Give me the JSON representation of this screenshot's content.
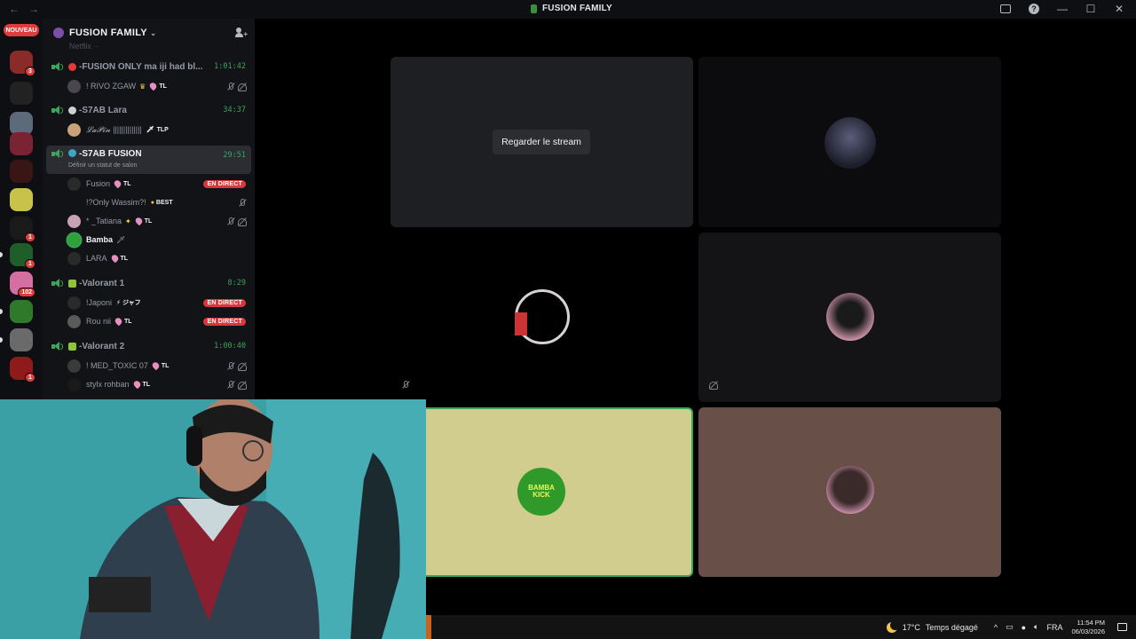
{
  "titlebar": {
    "back": "←",
    "forward": "→",
    "title": "FUSION FAMILY",
    "minimize": "—",
    "maximize": "☐",
    "close": "✕"
  },
  "rail": {
    "nouveau": "NOUVEAU",
    "servers": [
      {
        "badge": "3",
        "color": "#8c2a2a"
      },
      {
        "badge": "",
        "color": "#222222"
      },
      {
        "badge": "",
        "color": "#5d6a7b"
      },
      {
        "badge": "",
        "color": "#7a2332"
      },
      {
        "badge": "",
        "color": "#3a1515"
      },
      {
        "badge": "",
        "color": "#c9c24a"
      },
      {
        "badge": "1",
        "color": "#1a1a1a"
      },
      {
        "badge": "1",
        "color": "#1f5e2a"
      },
      {
        "badge": "102",
        "color": "#d46fa1"
      },
      {
        "badge": "",
        "color": "#2f7a2a"
      },
      {
        "badge": "",
        "color": "#6a6a6a"
      },
      {
        "badge": "1",
        "color": "#8f1a1a"
      }
    ]
  },
  "sidebar": {
    "guild_name": "FUSION FAMILY",
    "faded_channel": "Netflix ··",
    "channels": [
      {
        "name": "-FUSION ONLY ma iji had bl...",
        "timer": "1:01:42"
      },
      {
        "name": "-S7AB Lara",
        "timer": "34:37"
      },
      {
        "name": "-S7AB FUSION",
        "timer": "29:51",
        "status": "Définir un statut de salon"
      },
      {
        "name": "-Valorant 1",
        "timer": "8:29"
      },
      {
        "name": "-Valorant 2",
        "timer": "1:00:40"
      }
    ],
    "members": {
      "rivo": {
        "name": "! RIVO ZGAW",
        "tag": "TL"
      },
      "lapin": {
        "name": "𝓛𝓪𝓟𝓲𝓷 ||||||||||||||",
        "tag": "TLP"
      },
      "fusion": {
        "name": "Fusion",
        "tag": "TL",
        "live": "EN DIRECT"
      },
      "wassim": {
        "name": "!?Only Wassim?!",
        "tag": "BEST"
      },
      "tatiana": {
        "name": "* _Tatiana",
        "tag": "TL"
      },
      "bamba": {
        "name": "Bamba"
      },
      "lara": {
        "name": "LARA",
        "tag": "TL"
      },
      "japoni": {
        "name": "!Japoni",
        "tag": "ジャフ",
        "live": "EN DIRECT"
      },
      "rouni": {
        "name": "Rou nii",
        "tag": "TL",
        "live": "EN DIRECT"
      },
      "medtoxic": {
        "name": "! MED_TOXIC 07",
        "tag": "TL"
      },
      "stylx": {
        "name": "stylx rohban",
        "tag": "TL"
      }
    }
  },
  "stage": {
    "watch_stream": "Regarder le stream",
    "colors": {
      "bamba_tile": "#d0cd8e",
      "bamba_border": "#3ba55c",
      "pink_tile": "#685048"
    }
  },
  "taskbar": {
    "temperature": "17°C",
    "weather": "Temps dégagé",
    "language": "FRA",
    "time": "11:54 PM",
    "date": "06/03/2026"
  }
}
